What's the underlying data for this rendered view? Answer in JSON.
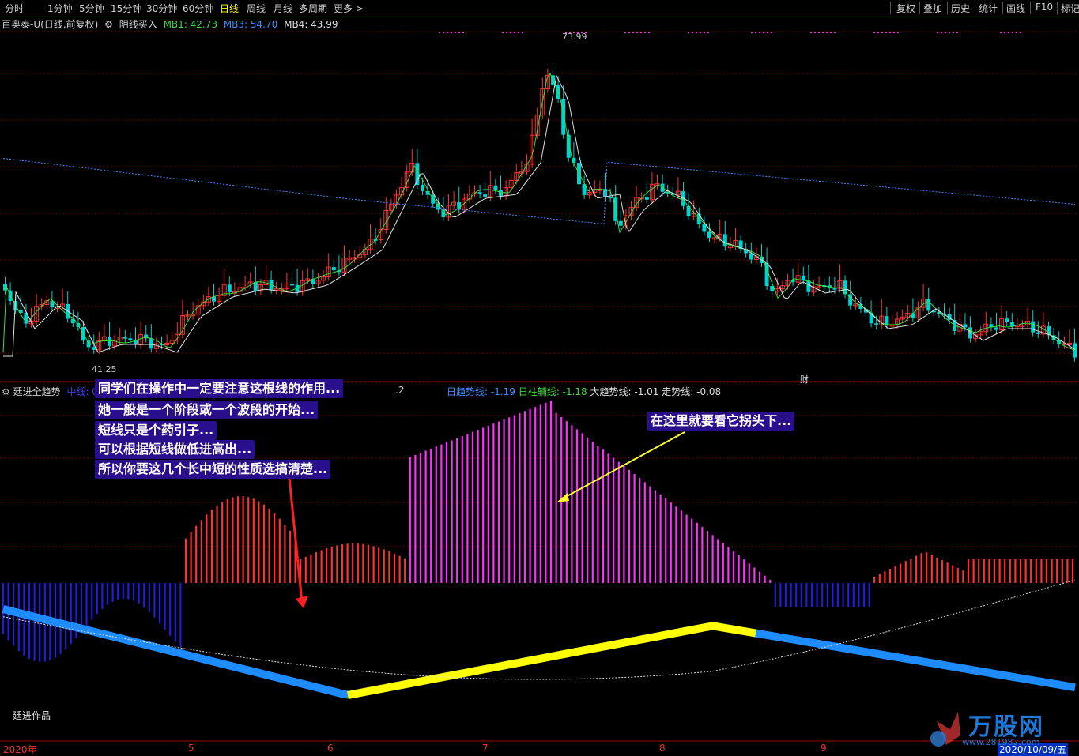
{
  "timeframes": [
    "分时",
    "1分钟",
    "5分钟",
    "15分钟",
    "30分钟",
    "60分钟",
    "日线",
    "周线",
    "月线",
    "多周期",
    "更多 >"
  ],
  "active_timeframe": "日线",
  "tools": [
    "复权",
    "叠加",
    "历史",
    "统计",
    "画线",
    "F10",
    "标记"
  ],
  "stock": {
    "name": "百奥泰-U(日线,前复权)",
    "indicator": "阴线买入",
    "mb1_label": "MB1: 42.73",
    "mb3_label": "MB3: 54.70",
    "mb4_label": "MB4: 43.99",
    "high_label": "73.99",
    "low_label": "41.25",
    "fin_marker": "财"
  },
  "indicator_panel": {
    "name": "廷进全趋势",
    "mid_line": "中线: 0",
    "mid_tail": ".2",
    "day_trend": "日趋势线: -1.19",
    "day_bar": "日柱辅线: -1.18",
    "big_trend": "大趋势线: -1.01",
    "walk_trend": "走势线: -0.08",
    "author": "廷进作品"
  },
  "callouts": {
    "left_lines": [
      "同学们在操作中一定要注意这根线的作用...",
      "她一般是一个阶段或一个波段的开始...",
      "短线只是个药引子...",
      "可以根据短线做低进高出...",
      "所以你要这几个长中短的性质选搞清楚..."
    ],
    "right": "在这里就要看它拐头下..."
  },
  "x_axis": [
    "2020年",
    "5",
    "6",
    "7",
    "8",
    "9",
    "2020/10/09/五"
  ],
  "watermark": {
    "brand": "万股网",
    "url": "www.281982.com"
  },
  "colors": {
    "up": "#ff3232",
    "down": "#00d2d2",
    "ma_green": "#3cdc3c",
    "ma_white": "#e0e0e0",
    "ma_blue": "#3c8cff",
    "magenta": "#ff30ff",
    "blue_bar": "#1e1edc",
    "teal": "#0aa0a0",
    "yellow": "#ffff00",
    "callout_bg": "#2a0f8c"
  }
}
